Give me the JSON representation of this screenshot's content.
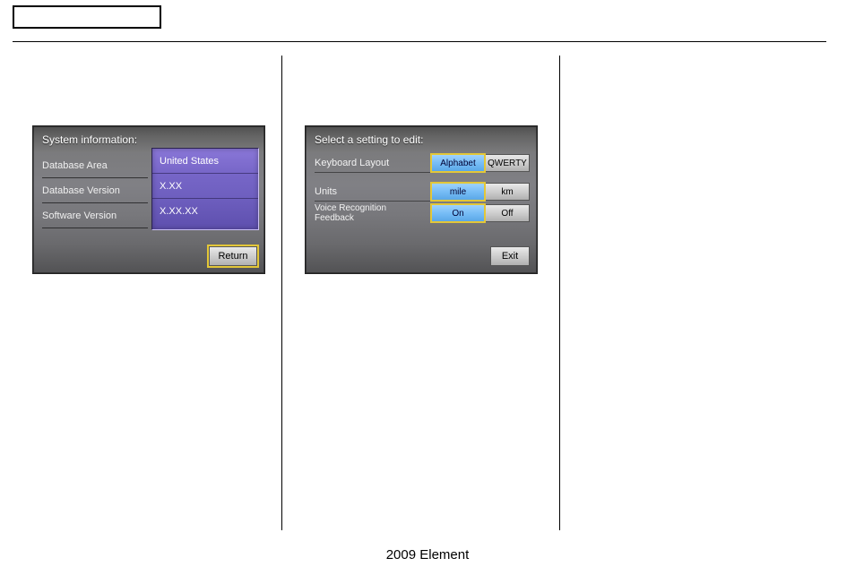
{
  "panel1": {
    "title": "System information:",
    "rows": [
      {
        "label": "Database Area",
        "value": "United States"
      },
      {
        "label": "Database Version",
        "value": "X.XX"
      },
      {
        "label": "Software Version",
        "value": "X.XX.XX"
      }
    ],
    "return_label": "Return"
  },
  "panel2": {
    "title": "Select a setting to edit:",
    "rows": [
      {
        "label": "Keyboard Layout",
        "opt1": "Alphabet",
        "opt2": "QWERTY",
        "selected": 0
      },
      {
        "label": "Units",
        "opt1": "mile",
        "opt2": "km",
        "selected": 0
      },
      {
        "label": "Voice Recognition Feedback",
        "opt1": "On",
        "opt2": "Off",
        "selected": 0
      }
    ],
    "exit_label": "Exit"
  },
  "footer": "2009 Element"
}
